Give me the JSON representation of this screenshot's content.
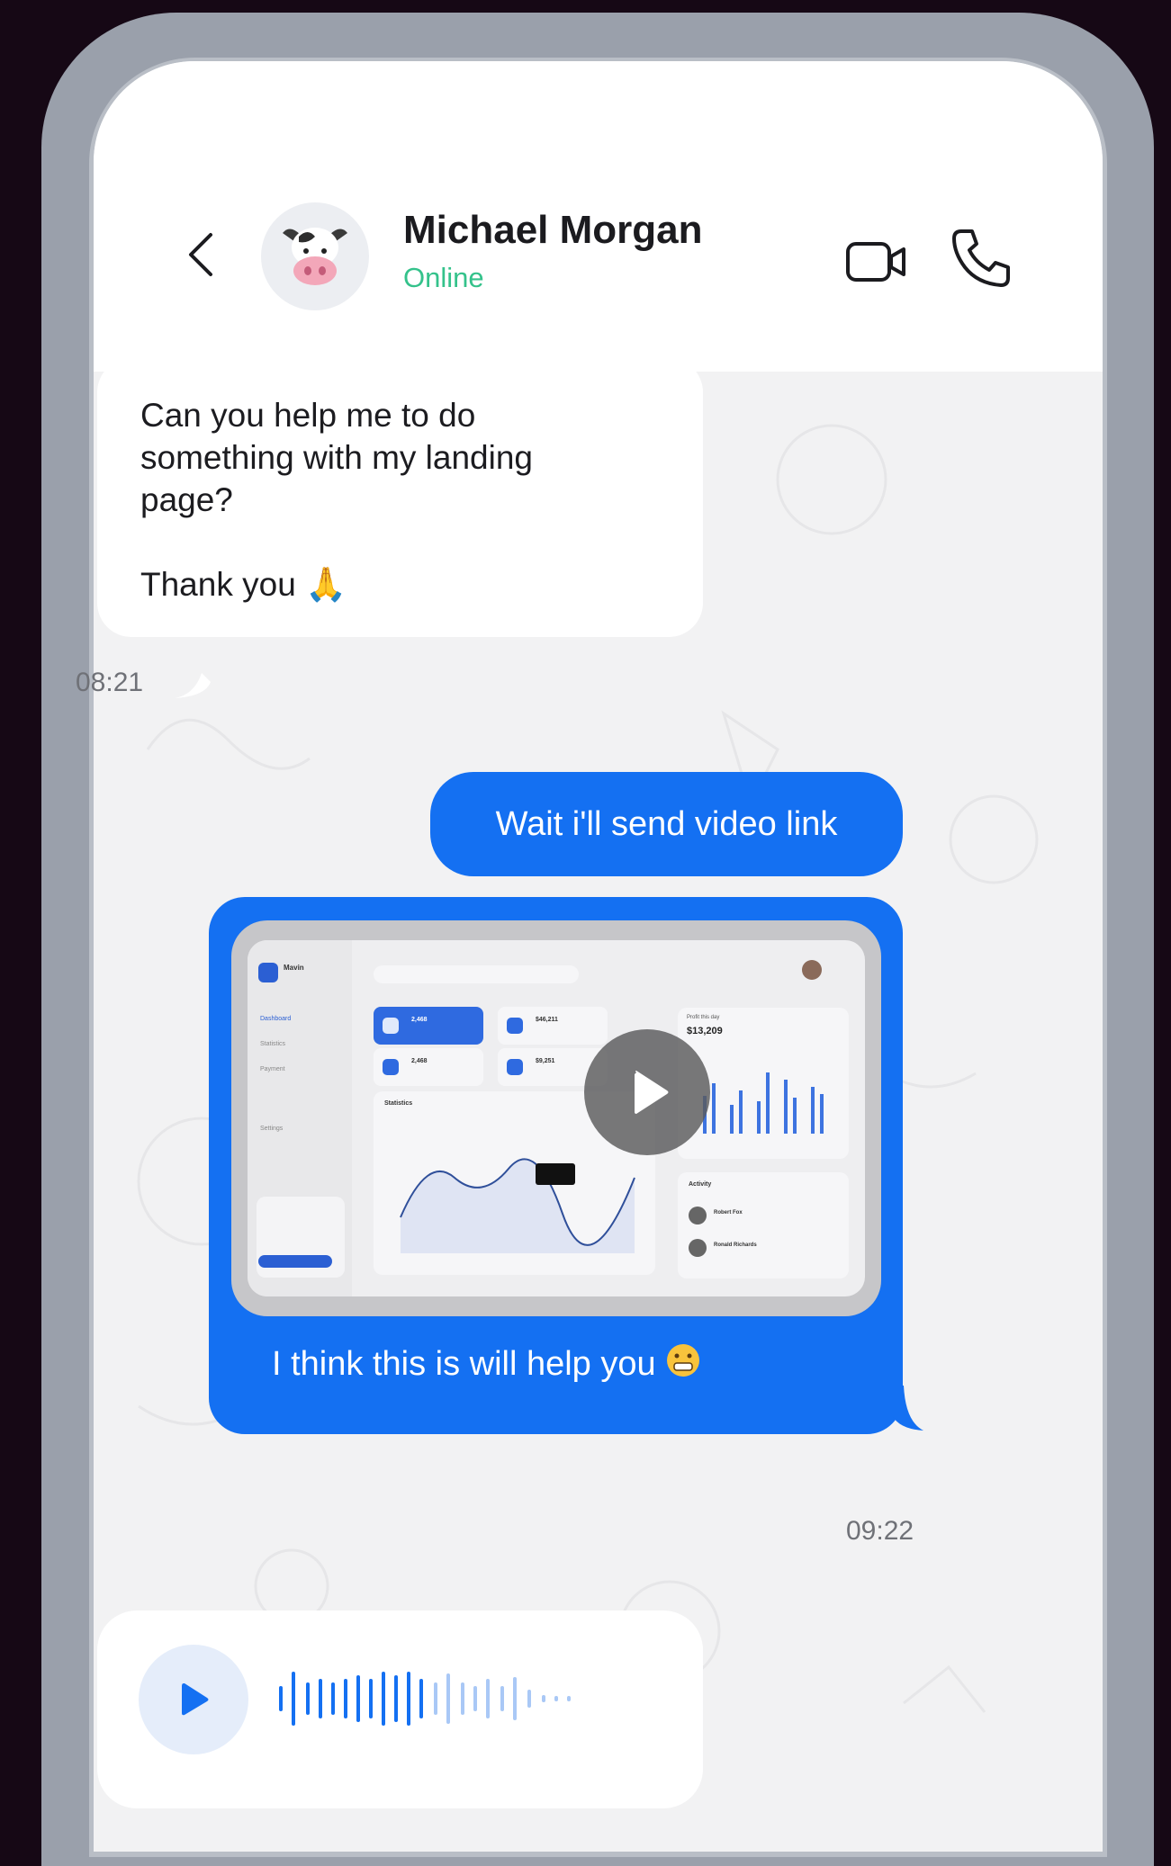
{
  "contact": {
    "name": "Michael Morgan",
    "status": "Online"
  },
  "icons": {
    "back": "chevron-left-icon",
    "avatar": "cow-emoji-avatar",
    "video_call": "video-camera-icon",
    "voice_call": "phone-icon",
    "play": "play-icon"
  },
  "messages": {
    "incoming_1": {
      "lines": [
        "Can you help me to do",
        "something with my landing",
        "page?",
        "Thank you 🙏"
      ],
      "time": "08:21"
    },
    "outgoing_1": {
      "text": "Wait i'll send video link"
    },
    "outgoing_2": {
      "caption": "I think this is will help you",
      "time": "09:22",
      "video": {
        "dashboard": {
          "logo": "Mavin",
          "nav": [
            "Dashboard",
            "Statistics",
            "Payment",
            "Settings"
          ],
          "cards": [
            "2,468",
            "$46,211",
            "2,468",
            "$9,251"
          ],
          "stats_title": "Statistics",
          "profit_label": "Profit this day",
          "profit_value": "$13,209",
          "activity_label": "Activity",
          "activity_rows": [
            "Robert Fox",
            "Ronald Richards"
          ]
        }
      }
    },
    "incoming_voice": {
      "type": "voice"
    }
  },
  "colors": {
    "outgoing_bubble": "#1470f2",
    "incoming_bubble": "#ffffff",
    "online_status": "#34c28b",
    "frame": "#9aa0ab",
    "background": "#160815"
  }
}
